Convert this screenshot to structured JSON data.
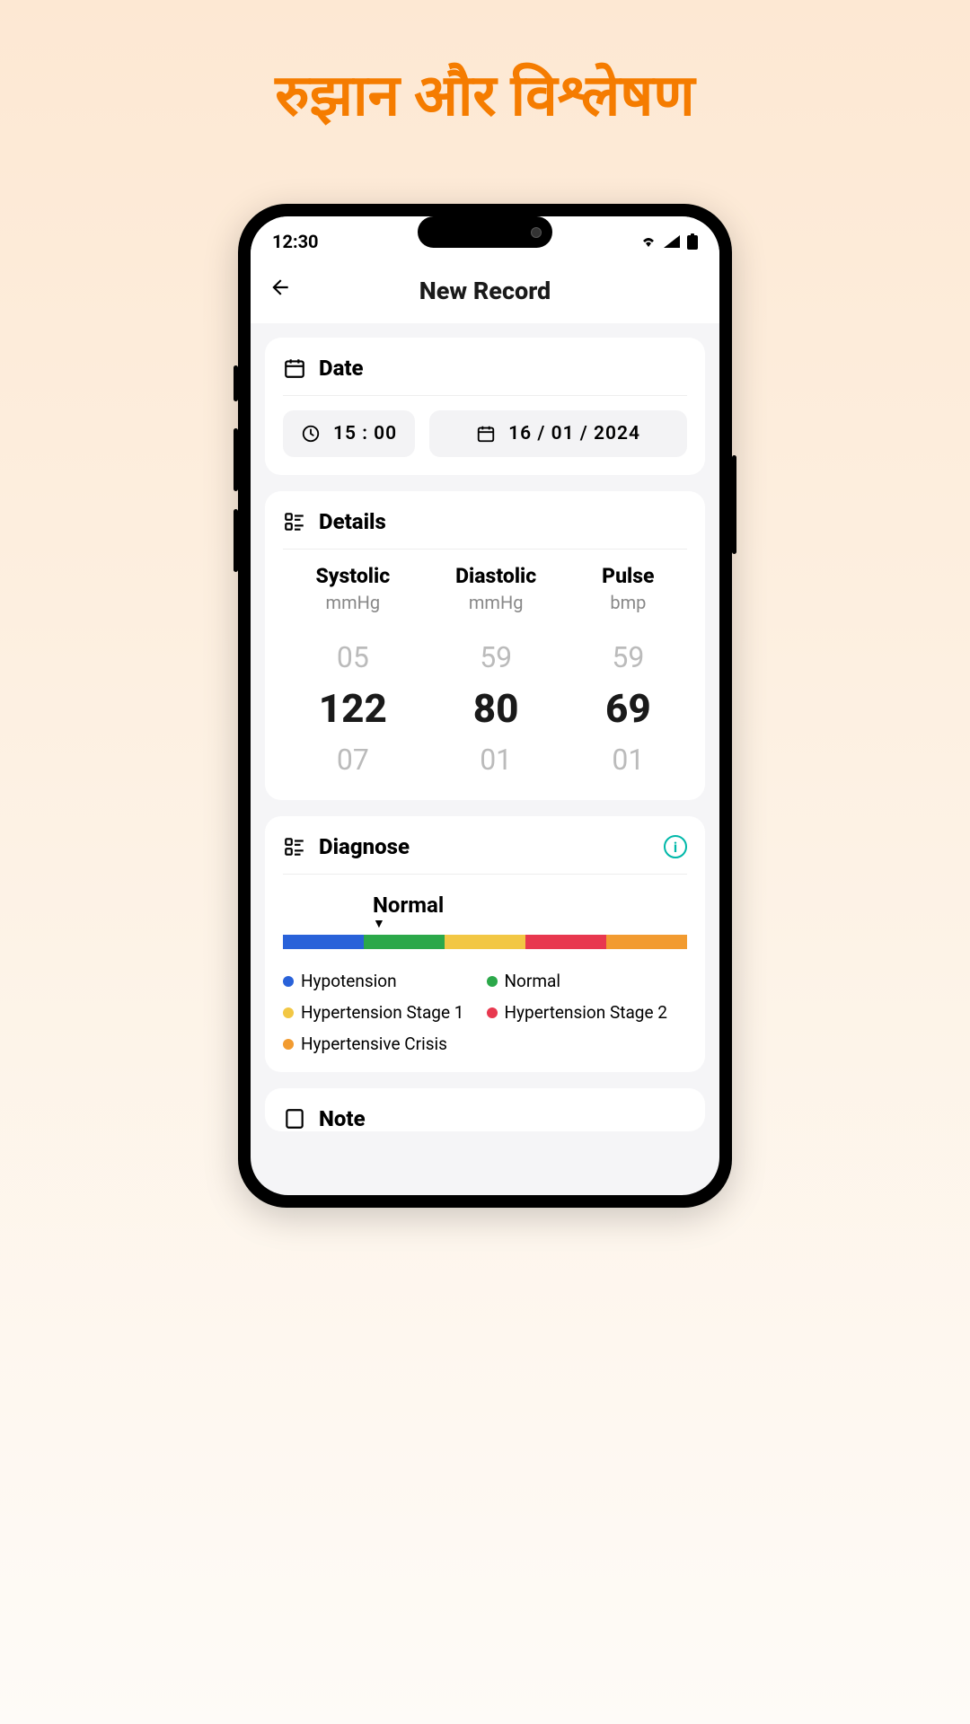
{
  "headline": "रुझान और विश्लेषण",
  "status": {
    "time": "12:30"
  },
  "header": {
    "title": "New Record"
  },
  "date_card": {
    "title": "Date",
    "time_value": "15  :  00",
    "date_value": "16 / 01 / 2024"
  },
  "details_card": {
    "title": "Details",
    "columns": [
      {
        "label": "Systolic",
        "unit": "mmHg",
        "prev": "05",
        "value": "122",
        "next": "07"
      },
      {
        "label": "Diastolic",
        "unit": "mmHg",
        "prev": "59",
        "value": "80",
        "next": "01"
      },
      {
        "label": "Pulse",
        "unit": "bmp",
        "prev": "59",
        "value": "69",
        "next": "01"
      }
    ]
  },
  "diagnose_card": {
    "title": "Diagnose",
    "current": "Normal",
    "legend": [
      {
        "color": "blue",
        "label": "Hypotension"
      },
      {
        "color": "green",
        "label": "Normal"
      },
      {
        "color": "yellow",
        "label": "Hypertension Stage 1"
      },
      {
        "color": "red",
        "label": "Hypertension Stage 2"
      },
      {
        "color": "orange",
        "label": "Hypertensive Crisis"
      }
    ]
  },
  "note_card": {
    "title": "Note"
  }
}
